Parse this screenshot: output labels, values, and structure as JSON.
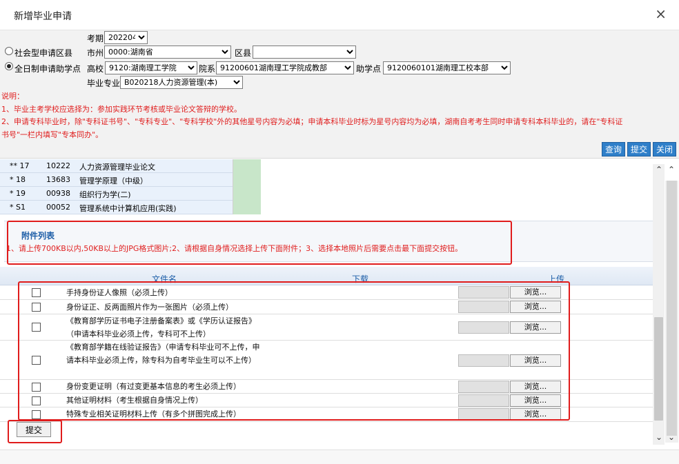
{
  "dialog": {
    "title": "新增毕业申请",
    "close_glyph": "×"
  },
  "form": {
    "exam_period_label": "考期",
    "exam_period_value": "202204",
    "city_label": "市州",
    "city_value": "0000:湖南省",
    "county_label": "区县",
    "county_value": "",
    "radio_social": "社会型申请区县",
    "radio_fulltime": "全日制申请助学点",
    "university_label": "高校",
    "university_value": "9120:湖南理工学院",
    "college_label": "院系",
    "college_value": "91200601湖南理工学院成教部",
    "assist_label": "助学点",
    "assist_value": "9120060101湖南理工校本部",
    "major_label": "毕业专业",
    "major_value": "B020218人力资源管理(本)"
  },
  "notes": {
    "heading": "说明：",
    "line1": "1、毕业主考学校应选择为：参加实践环节考核或毕业论文答辩的学校。",
    "line2a": "2、申请专科毕业时，除\"专科证书号\"、\"专科专业\"、\"专科学校\"外的其他星号内容为必填；申请本科毕业时标为星号内容均为必填，湖南自考考生同时申请专科本科毕业的，请在\"专科证",
    "line2b": "书号\"一栏内填写\"专本同办\"。"
  },
  "top_buttons": {
    "query": "查询",
    "submit": "提交",
    "close": "关闭"
  },
  "courses": [
    {
      "mark": "** 17",
      "code": "10222",
      "name": "人力资源管理毕业论文"
    },
    {
      "mark": "*  18",
      "code": "13683",
      "name": "管理学原理（中级）"
    },
    {
      "mark": "*  19",
      "code": "00938",
      "name": "组织行为学(二)"
    },
    {
      "mark": "*  S1",
      "code": "00052",
      "name": "管理系统中计算机应用(实践)"
    }
  ],
  "attachments": {
    "title": "附件列表",
    "note": "1、请上传700KB以内,50KB以上的JPG格式图片;2、请根据自身情况选择上传下面附件；3、选择本地照片后需要点击最下面提交按钮。",
    "col_filename": "文件名",
    "col_download": "下载",
    "col_upload": "上传",
    "browse_label": "浏览...",
    "rows": [
      {
        "name": "手持身份证人像照（必须上传）"
      },
      {
        "name": "身份证正、反两面照片作为一张图片（必须上传）"
      },
      {
        "name": "《教育部学历证书电子注册备案表》或《学历认证报告》（申请本科毕业必须上传，专科可不上传）"
      },
      {
        "name": "《教育部学籍在线验证报告》（申请专科毕业可不上传，申请本科毕业必须上传，除专科为自考毕业生可以不上传）"
      },
      {
        "name": "身份变更证明（有过变更基本信息的考生必须上传）"
      },
      {
        "name": "其他证明材料（考生根据自身情况上传）"
      },
      {
        "name": "特殊专业相关证明材料上传（有多个拼图完成上传）"
      }
    ]
  },
  "bottom": {
    "submit_label": "提交"
  },
  "colors": {
    "accent_blue": "#2f7fc9",
    "highlight_red": "#e01b1b",
    "note_red": "#e02020",
    "pass_green": "#c8e6c9"
  }
}
